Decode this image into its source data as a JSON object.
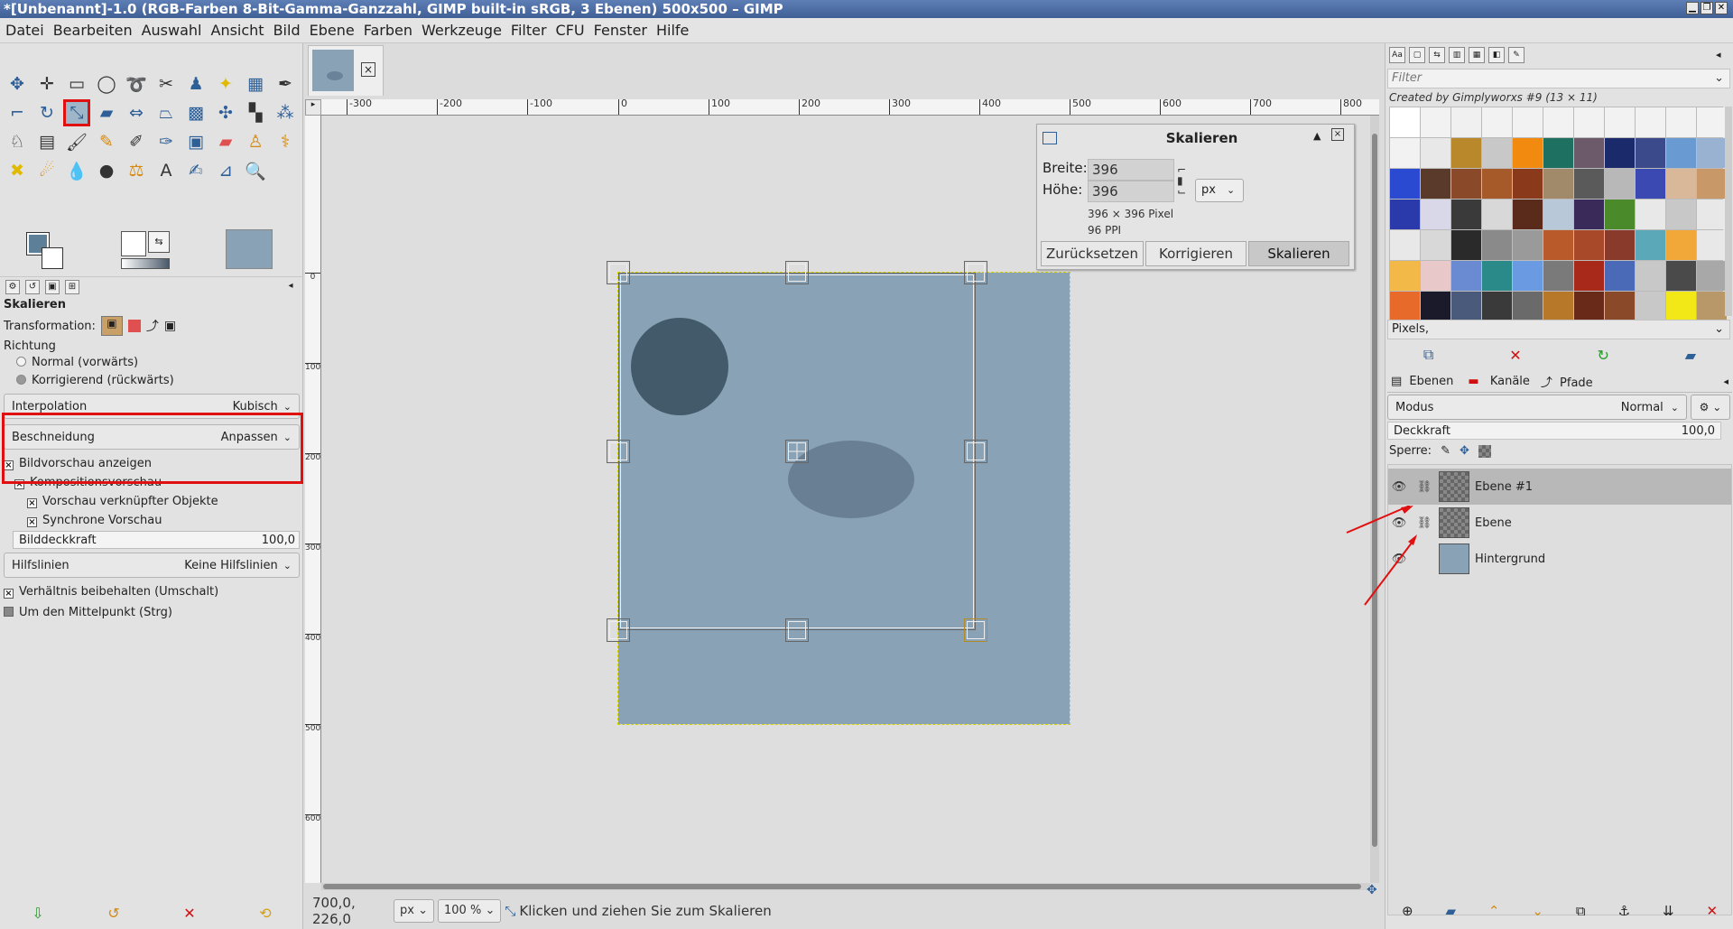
{
  "window": {
    "title": "*[Unbenannt]-1.0 (RGB-Farben 8-Bit-Gamma-Ganzzahl, GIMP built-in sRGB, 3 Ebenen) 500x500 – GIMP"
  },
  "menu": [
    "Datei",
    "Bearbeiten",
    "Auswahl",
    "Ansicht",
    "Bild",
    "Ebene",
    "Farben",
    "Werkzeuge",
    "Filter",
    "CFU",
    "Fenster",
    "Hilfe"
  ],
  "tool_options": {
    "title": "Skalieren",
    "transformation_label": "Transformation:",
    "direction_label": "Richtung",
    "direction_normal": "Normal (vorwärts)",
    "direction_corrective": "Korrigierend (rückwärts)",
    "interpolation_label": "Interpolation",
    "interpolation_value": "Kubisch",
    "clipping_label": "Beschneidung",
    "clipping_value": "Anpassen",
    "show_preview": "Bildvorschau anzeigen",
    "composite_preview": "Kompositionsvorschau",
    "linked_preview": "Vorschau verknüpfter Objekte",
    "sync_preview": "Synchrone Vorschau",
    "image_opacity_label": "Bilddeckkraft",
    "image_opacity_value": "100,0",
    "guides_label": "Hilfslinien",
    "guides_value": "Keine Hilfslinien",
    "keep_aspect": "Verhältnis beibehalten (Umschalt)",
    "around_center": "Um den Mittelpunkt (Strg)"
  },
  "ruler": {
    "h_ticks": [
      "-300",
      "-200",
      "-100",
      "0",
      "100",
      "200",
      "300",
      "400",
      "500",
      "600",
      "700",
      "800"
    ],
    "v_ticks": [
      "0",
      "100",
      "200",
      "300",
      "400",
      "500",
      "600"
    ]
  },
  "scale_dialog": {
    "title": "Skalieren",
    "width_label": "Breite:",
    "width_value": "396",
    "height_label": "Höhe:",
    "height_value": "396",
    "unit": "px",
    "size_info": "396 × 396 Pixel",
    "ppi_info": "96 PPI",
    "reset_button": "Zurücksetzen",
    "readjust_button": "Korrigieren",
    "scale_button": "Skalieren"
  },
  "patterns": {
    "filter_placeholder": "Filter",
    "created_by": "Created by Gimplyworxs #9 (13 × 11)",
    "selected_name": "Pixels,",
    "swatches": [
      "#ffffff",
      "#f2f2f2",
      "#f0f0f0",
      "#f2f2f2",
      "#f2f2f2",
      "#f2f2f2",
      "#f2f2f2",
      "#f2f2f2",
      "#f2f2f2",
      "#f2f2f2",
      "#f2f2f2",
      "#f2f2f2",
      "#e8e8e8",
      "#b8882a",
      "#c8c8c8",
      "#f28a10",
      "#1e7060",
      "#6c5a6a",
      "#1a2a6a",
      "#3a4a8a",
      "#6a9ad2",
      "#9ab2d2",
      "#2a4ad2",
      "#5a3a2a",
      "#8a4a2a",
      "#a65a2a",
      "#8a3a1a",
      "#a08a6a",
      "#5a5a5a",
      "#b8b8b8",
      "#3a4ab2",
      "#d8b898",
      "#c89868",
      "#2a3aaa",
      "#d8d8e8",
      "#3a3a3a",
      "#d8d8d8",
      "#5a2a1a",
      "#b8c8d8",
      "#3a2a5a",
      "#4a8a2a",
      "#e8e8e8",
      "#c8c8c8",
      "#e8e8e8",
      "#e8e8e8",
      "#d8d8d8",
      "#2a2a2a",
      "#8a8a8a",
      "#9a9a9a",
      "#b85a2a",
      "#a84a2a",
      "#8a3a2a",
      "#5aa8b8",
      "#f2a838",
      "#e8e8e8",
      "#f2b848",
      "#e8c8c8",
      "#6a8ad2",
      "#2a8a8a",
      "#6a9ae2",
      "#7a7a7a",
      "#a8281a",
      "#4a6ab8",
      "#c8c8c8",
      "#4a4a4a",
      "#a8a8a8",
      "#e86a2a",
      "#1a1a2a",
      "#4a5a7a",
      "#3a3a3a",
      "#6a6a6a",
      "#b8782a",
      "#6a2a1a",
      "#8a4a2a",
      "#c8c8c8",
      "#f2e818",
      "#b89868"
    ],
    "buttons": [
      "pattern-edit-icon",
      "delete-icon",
      "refresh-icon",
      "open-as-image-icon"
    ]
  },
  "layers_panel": {
    "tabs": [
      "Ebenen",
      "Kanäle",
      "Pfade"
    ],
    "mode_label": "Modus",
    "mode_value": "Normal",
    "opacity_label": "Deckkraft",
    "opacity_value": "100,0",
    "lock_label": "Sperre:",
    "layers": [
      {
        "name": "Ebene #1",
        "selected": true
      },
      {
        "name": "Ebene",
        "selected": false
      },
      {
        "name": "Hintergrund",
        "selected": false
      }
    ]
  },
  "status": {
    "coords": "700,0, 226,0",
    "unit": "px",
    "zoom": "100 %",
    "message": "Klicken und ziehen Sie zum Skalieren"
  },
  "colors": {
    "image_bg": "#8aa2b5",
    "circle": "#435a6a",
    "ellipse": "#687f94",
    "highlight": "#e01010"
  }
}
